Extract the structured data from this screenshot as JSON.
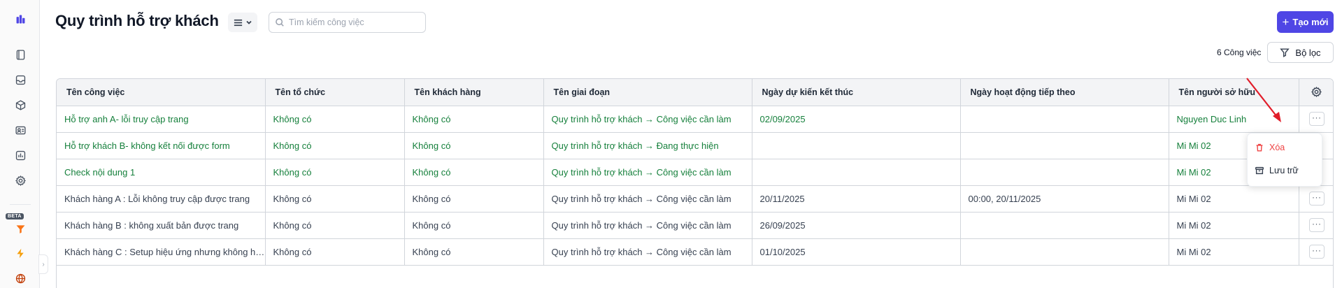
{
  "header": {
    "title": "Quy trình hỗ trợ khách",
    "search_placeholder": "Tìm kiếm công việc",
    "search_value": "",
    "create_label": "Tạo mới",
    "create_icon": "+",
    "task_count": "6 Công việc",
    "filter_label": "Bộ lọc"
  },
  "sidebar": {
    "beta": "BETA",
    "collapse_icon": "›"
  },
  "table": {
    "columns": [
      "Tên công việc",
      "Tên tổ chức",
      "Tên khách hàng",
      "Tên giai đoạn",
      "Ngày dự kiến kết thúc",
      "Ngày hoạt động tiếp theo",
      "Tên người sở hữu"
    ],
    "row_action": "···",
    "rows": [
      [
        "Hỗ trợ anh A- lỗi truy cập trang",
        "Không có",
        "Không có",
        "Quy trình hỗ trợ khách → Công việc cần làm",
        "02/09/2025",
        "",
        "Nguyen Duc Linh"
      ],
      [
        "Hỗ trợ khách B- không kết nối được form",
        "Không có",
        "Không có",
        "Quy trình hỗ trợ khách → Đang thực hiện",
        "",
        "",
        "Mi Mi 02"
      ],
      [
        "Check nội dung 1",
        "Không có",
        "Không có",
        "Quy trình hỗ trợ khách → Công việc cần làm",
        "",
        "",
        "Mi Mi 02"
      ],
      [
        "Khách hàng A : Lỗi không truy cập được trang",
        "Không có",
        "Không có",
        "Quy trình hỗ trợ khách → Công việc cần làm",
        "20/11/2025",
        "00:00, 20/11/2025",
        "Mi Mi 02"
      ],
      [
        "Khách hàng B : không xuất bản được trang",
        "Không có",
        "Không có",
        "Quy trình hỗ trợ khách → Công việc cần làm",
        "26/09/2025",
        "",
        "Mi Mi 02"
      ],
      [
        "Khách hàng C : Setup hiệu ứng nhưng không hoạt động",
        "Không có",
        "Không có",
        "Quy trình hỗ trợ khách → Công việc cần làm",
        "01/10/2025",
        "",
        "Mi Mi 02"
      ]
    ]
  },
  "menu": {
    "delete_label": "Xóa",
    "archive_label": "Lưu trữ"
  },
  "colors": {
    "accent": "#4f46e5",
    "green_text": "#16803c",
    "danger": "#ef4444",
    "annotation": "#e11d2a"
  }
}
